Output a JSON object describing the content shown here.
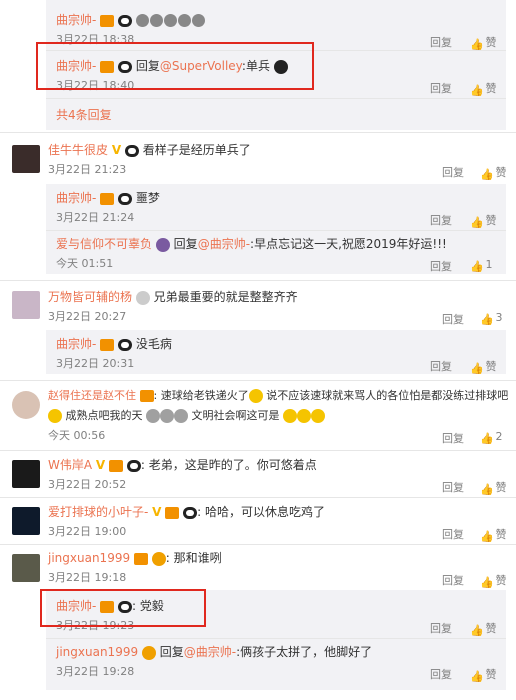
{
  "t1": {
    "name": "曲宗帅-",
    "text": "",
    "time": "3月22日 18:38",
    "reply": "回复",
    "like": "赞"
  },
  "t2": {
    "name": "曲宗帅-",
    "reply_prefix": "回复",
    "mention": "@SuperVolley",
    "text": ":单兵",
    "time": "3月22日 18:40",
    "reply": "回复",
    "like": "赞"
  },
  "more": "共4条回复",
  "c1": {
    "name": "佳牛牛很皮",
    "text": "看样子是经历单兵了",
    "time": "3月22日 21:23",
    "reply": "回复",
    "like": "赞"
  },
  "c1r1": {
    "name": "曲宗帅-",
    "text": "噩梦",
    "time": "3月22日 21:24",
    "reply": "回复",
    "like": "赞"
  },
  "c1r2": {
    "name": "爱与信仰不可辜负",
    "reply_prefix": "回复",
    "mention": "@曲宗帅-",
    "text": ":早点忘记这一天,祝愿2019年好运!!!",
    "time": "今天 01:51",
    "reply": "回复",
    "like": "1"
  },
  "c2": {
    "name": "万物皆可辅的杨",
    "text": "兄弟最重要的就是整整齐齐",
    "time": "3月22日 20:27",
    "reply": "回复",
    "like": "3"
  },
  "c2r1": {
    "name": "曲宗帅-",
    "text": "没毛病",
    "time": "3月22日 20:31",
    "reply": "回复",
    "like": "赞"
  },
  "c3": {
    "name": "赵得住还是赵不住",
    "text1": "速球给老铁递火了",
    "text2": "说不应该速球就来骂人的各位怕是都没练过排球吧",
    "text3": "成熟点吧我的天",
    "text4": "文明社会啊这可是",
    "time": "今天 00:56",
    "reply": "回复",
    "like": "2"
  },
  "c4": {
    "name": "W伟岸A",
    "text": "老弟，这是昨的了。你可悠着点",
    "time": "3月22日 20:52",
    "reply": "回复",
    "like": "赞"
  },
  "c5": {
    "name": "爱打排球的小叶子-",
    "text": "哈哈，可以休息吃鸡了",
    "time": "3月22日 19:00",
    "reply": "回复",
    "like": "赞"
  },
  "c6": {
    "name": "jingxuan1999",
    "text": "那和谁咧",
    "time": "3月22日 19:18",
    "reply": "回复",
    "like": "赞"
  },
  "c6r1": {
    "name": "曲宗帅-",
    "text": "党毅",
    "time": "3月22日 19:23",
    "reply": "回复",
    "like": "赞"
  },
  "c6r2": {
    "name": "jingxuan1999",
    "reply_prefix": "回复",
    "mention": "@曲宗帅-",
    "text": ":俩孩子太拼了，他脚好了",
    "time": "3月22日 19:28",
    "reply": "回复",
    "like": "赞"
  },
  "colors": {
    "accent": "#eb7350",
    "highlight": "#e0281e",
    "sub_bg": "#f2f2f5"
  }
}
